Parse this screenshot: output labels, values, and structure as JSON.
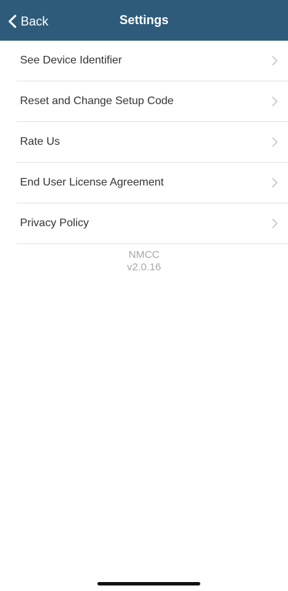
{
  "colors": {
    "navbar_background": "#2f5b7b",
    "navbar_text": "#ffffff",
    "item_text": "#333333",
    "divider": "#e2e2e2",
    "muted_text": "#a7a7a7",
    "chevron": "#c7c7cc"
  },
  "navbar": {
    "back_label": "Back",
    "back_icon": "chevron-left-icon",
    "title": "Settings"
  },
  "settings": {
    "items": [
      {
        "label": "See Device Identifier",
        "icon": "chevron-right-icon"
      },
      {
        "label": "Reset and Change Setup Code",
        "icon": "chevron-right-icon"
      },
      {
        "label": "Rate Us",
        "icon": "chevron-right-icon"
      },
      {
        "label": "End User License Agreement",
        "icon": "chevron-right-icon"
      },
      {
        "label": "Privacy Policy",
        "icon": "chevron-right-icon"
      }
    ]
  },
  "footer": {
    "app_name": "NMCC",
    "version": "v2.0.16"
  }
}
